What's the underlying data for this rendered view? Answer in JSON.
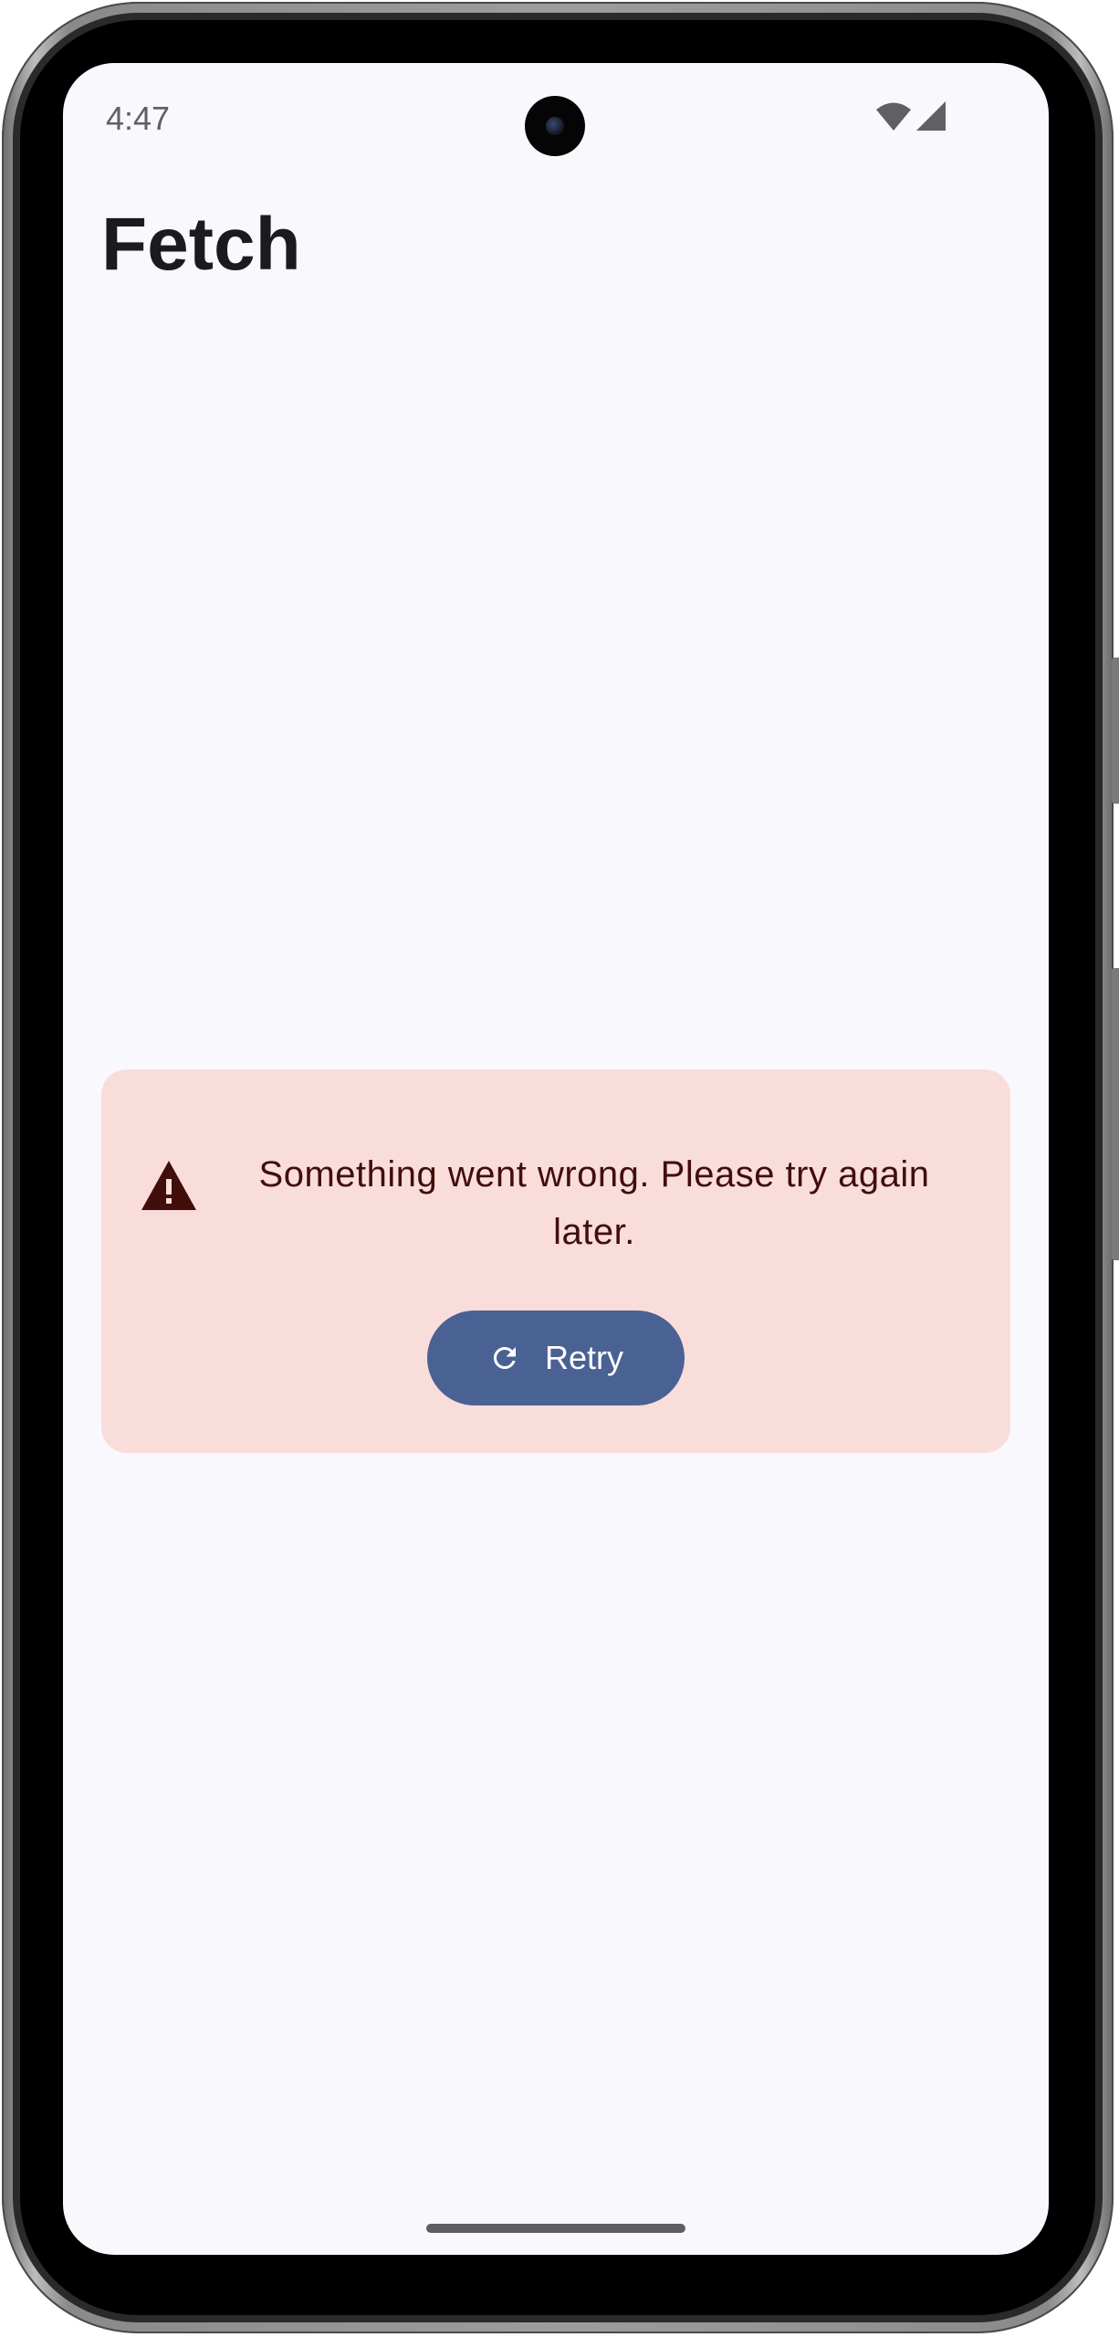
{
  "status_bar": {
    "time": "4:47",
    "icons": [
      "wifi-icon",
      "cellular-signal-icon"
    ]
  },
  "app": {
    "title": "Fetch"
  },
  "error": {
    "message": "Something went wrong. Please try again later.",
    "icon": "warning-icon",
    "retry_label": "Retry",
    "retry_icon": "refresh-icon"
  },
  "colors": {
    "background": "#f9f8fd",
    "error_container": "#f9dddb",
    "on_error_container": "#410e0b",
    "primary": "#4a6194",
    "on_primary": "#ffffff"
  }
}
